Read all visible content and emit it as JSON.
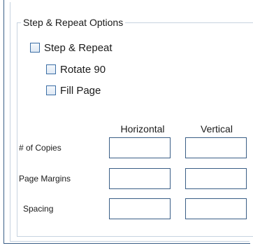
{
  "group": {
    "title": "Step & Repeat Options"
  },
  "options": {
    "step_repeat": {
      "label": "Step & Repeat",
      "checked": false
    },
    "rotate_90": {
      "label": "Rotate 90",
      "checked": false
    },
    "fill_page": {
      "label": "Fill Page",
      "checked": false
    }
  },
  "grid": {
    "columns": [
      "Horizontal",
      "Vertical"
    ],
    "rows": [
      {
        "label": "# of Copies",
        "horizontal": "",
        "vertical": ""
      },
      {
        "label": "Page Margins",
        "horizontal": "",
        "vertical": ""
      },
      {
        "label": "Spacing",
        "horizontal": "",
        "vertical": ""
      }
    ]
  },
  "colors": {
    "border_dark": "#3a5e86",
    "border_light": "#c7d3e0",
    "checkbox_border": "#3b6ea5"
  }
}
